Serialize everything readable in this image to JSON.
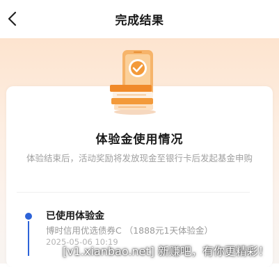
{
  "header": {
    "back_icon": "chevron-left-icon",
    "title": "完成结果"
  },
  "card": {
    "illustration_icon": "phone-check-receipt-icon",
    "title": "体验金使用情况",
    "description": "体验结束后，活动奖励将发放现金至银行卡后发起基金申购"
  },
  "timeline": [
    {
      "title": "已使用体验金",
      "subtitle": "博时信用优选债券C （1888元1天体验金）",
      "date": "2025-05-06 10:19"
    }
  ],
  "watermark": "[v1.xianbao.net] 新赚吧，有你更精彩！",
  "colors": {
    "accent_blue": "#2d63d8",
    "hero_top": "#fde4cf",
    "illustration_orange": "#f39a3a"
  }
}
